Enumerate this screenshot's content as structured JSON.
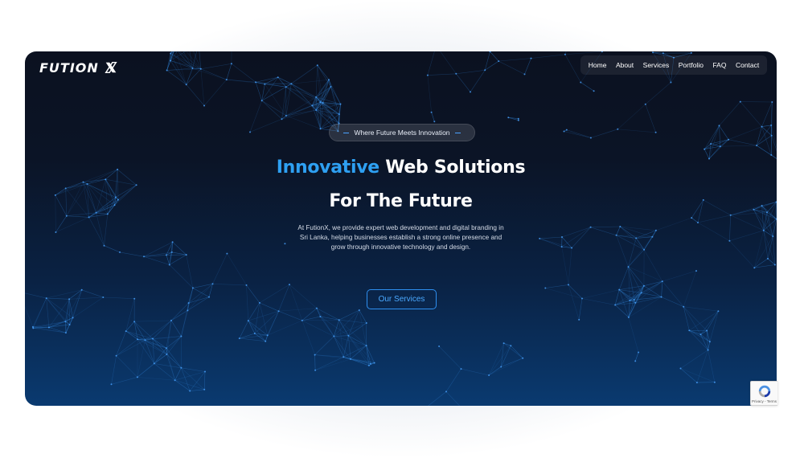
{
  "brand": {
    "name": "FUTION",
    "mark": "X"
  },
  "nav": {
    "items": [
      {
        "label": "Home"
      },
      {
        "label": "About"
      },
      {
        "label": "Services"
      },
      {
        "label": "Portfolio"
      },
      {
        "label": "FAQ"
      },
      {
        "label": "Contact"
      }
    ]
  },
  "hero": {
    "tagline": "Where Future Meets Innovation",
    "headline_accent": "Innovative",
    "headline_rest": "Web Solutions",
    "headline_line2": "For The Future",
    "description": "At FutionX, we provide expert web development and digital branding in Sri Lanka, helping businesses establish a strong online presence and grow through innovative technology and design.",
    "cta_label": "Our Services"
  },
  "recaptcha": {
    "text": "Privacy - Terms",
    "icon": "recaptcha-icon"
  },
  "colors": {
    "accent": "#2ea0f2",
    "background_top": "#0b1120",
    "background_bottom": "#0a3a70",
    "network_lines": "#2f7fd0"
  }
}
